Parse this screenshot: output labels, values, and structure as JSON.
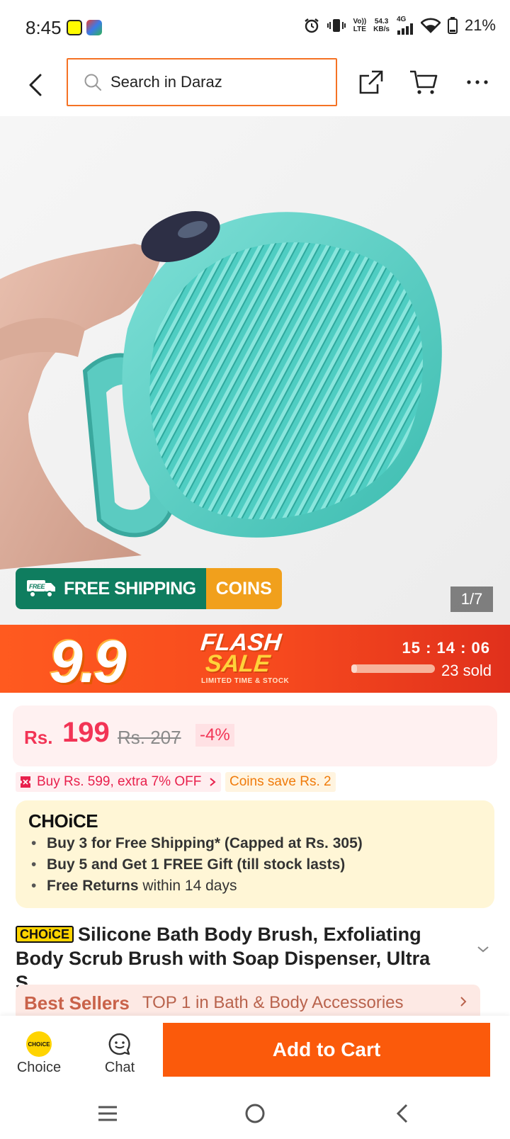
{
  "status_bar": {
    "time": "8:45",
    "network_line1": "Vo))",
    "network_line2": "LTE",
    "speed_line1": "54.3",
    "speed_line2": "KB/s",
    "gen": "4G",
    "battery": "21%"
  },
  "header": {
    "search_placeholder": "Search in Daraz"
  },
  "product_image": {
    "shipping_badge_free": "FREE",
    "shipping_badge_label": "FREE SHIPPING",
    "coins_badge_label": "COINS",
    "counter": "1/7"
  },
  "flash_sale": {
    "event": "9.9",
    "title_line1": "FLASH",
    "title_line2": "SALE",
    "subtitle": "LIMITED TIME & STOCK",
    "countdown": "15 : 14 : 06",
    "sold_text": "23 sold",
    "sold_progress_fraction": 0.05
  },
  "price": {
    "currency": "Rs.",
    "current": "199",
    "original": "Rs. 207",
    "discount": "-4%"
  },
  "promos": {
    "buy_more": "Buy Rs. 599, extra 7% OFF",
    "coins": "Coins save Rs. 2"
  },
  "choice": {
    "logo": "CHOiCE",
    "items": [
      {
        "bold": "Buy 3 for  Free Shipping* (Capped at Rs. 305)",
        "rest": ""
      },
      {
        "bold": "Buy 5 and Get 1 FREE Gift (till stock lasts)",
        "rest": ""
      },
      {
        "bold": "Free Returns",
        "rest": " within 14 days"
      }
    ]
  },
  "product": {
    "chip": "CHOiCE",
    "title_line1": "Silicone Bath Body Brush, Exfoliating",
    "title_line2": "Body Scrub Brush with Soap Dispenser, Ultra S..."
  },
  "best_sellers": {
    "logo": "Best Sellers",
    "text": "TOP 1 in Bath & Body Accessories"
  },
  "bottom_bar": {
    "choice_badge": "CHOiCE",
    "choice_label": "Choice",
    "chat_label": "Chat",
    "add_to_cart": "Add to Cart"
  },
  "colors": {
    "brand_orange": "#f57224",
    "cta": "#fb5a0b",
    "price_red": "#f23455",
    "shipping_green": "#0f7d5f",
    "coins_gold": "#f1a01c",
    "choice_yellow": "#ffd400"
  },
  "icons": [
    "back-icon",
    "search-icon",
    "share-icon",
    "cart-icon",
    "more-icon",
    "chat-icon",
    "chevron-down-icon",
    "chevron-right-icon"
  ]
}
